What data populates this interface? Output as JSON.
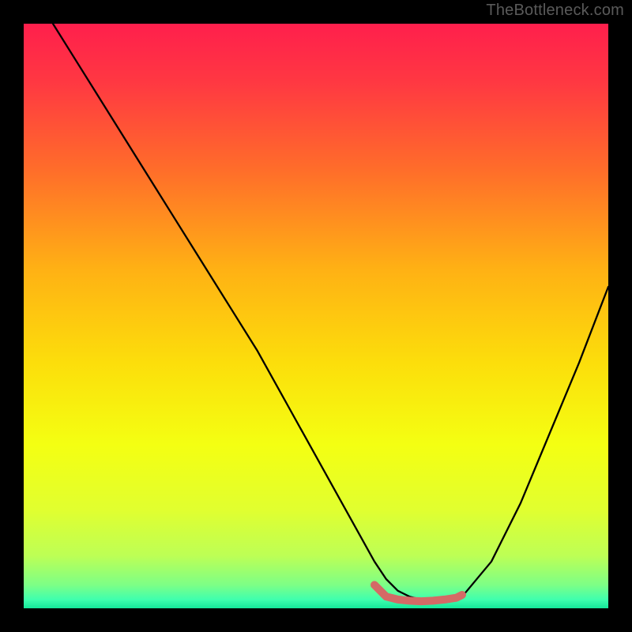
{
  "watermark": "TheBottleneck.com",
  "chart_data": {
    "type": "line",
    "title": "",
    "xlabel": "",
    "ylabel": "",
    "xlim": [
      0,
      100
    ],
    "ylim": [
      0,
      100
    ],
    "gradient_stops": [
      {
        "offset": 0.0,
        "color": "#ff1f4c"
      },
      {
        "offset": 0.1,
        "color": "#ff3842"
      },
      {
        "offset": 0.25,
        "color": "#ff6d2a"
      },
      {
        "offset": 0.42,
        "color": "#ffb114"
      },
      {
        "offset": 0.58,
        "color": "#fcde0b"
      },
      {
        "offset": 0.72,
        "color": "#f4ff12"
      },
      {
        "offset": 0.83,
        "color": "#e1ff2f"
      },
      {
        "offset": 0.91,
        "color": "#bdff55"
      },
      {
        "offset": 0.96,
        "color": "#7dff86"
      },
      {
        "offset": 0.985,
        "color": "#3fffae"
      },
      {
        "offset": 1.0,
        "color": "#15e79a"
      }
    ],
    "series": [
      {
        "name": "bottleneck-curve",
        "x": [
          5,
          10,
          15,
          20,
          25,
          30,
          35,
          40,
          45,
          50,
          55,
          60,
          62,
          64,
          66,
          68,
          70,
          72,
          75,
          80,
          85,
          90,
          95,
          100
        ],
        "y": [
          100,
          92,
          84,
          76,
          68,
          60,
          52,
          44,
          35,
          26,
          17,
          8,
          5,
          3,
          2,
          1.5,
          1.3,
          1.5,
          2,
          8,
          18,
          30,
          42,
          55
        ]
      }
    ],
    "highlight": {
      "name": "flat-highlight",
      "x": [
        60,
        62,
        64,
        66,
        68,
        70,
        72,
        74,
        75
      ],
      "y": [
        4,
        2,
        1.5,
        1.3,
        1.2,
        1.3,
        1.5,
        1.8,
        2.3
      ],
      "color": "#d46a66"
    }
  }
}
